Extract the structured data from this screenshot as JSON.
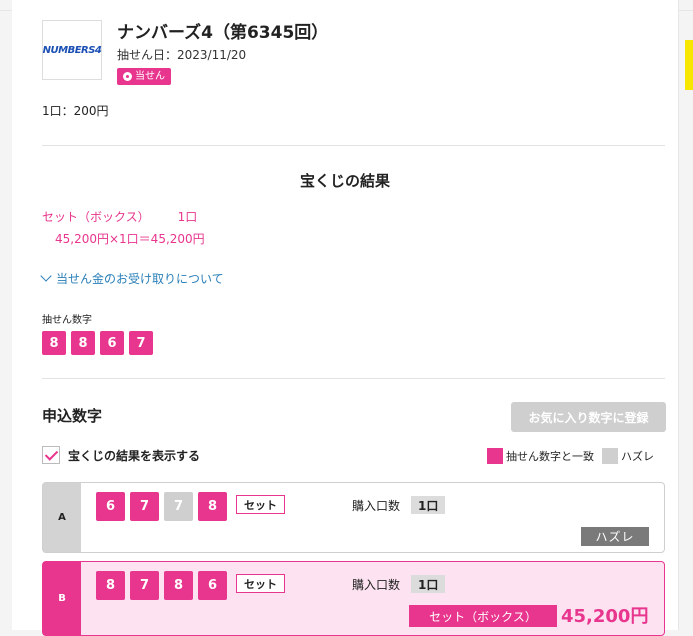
{
  "lottery": {
    "title": "ナンバーズ4（第6345回）",
    "draw_date": "抽せん日：2023/11/20",
    "badge": "当せん",
    "logo_text": "NUMBERS4",
    "price": "1口：200円"
  },
  "results": {
    "heading": "宝くじの結果",
    "prize_type": "セット（ボックス）",
    "prize_count": "1口",
    "prize_calc": "45,200円×1口＝45,200円",
    "prize_link": "当せん金のお受け取りについて",
    "drawn_label": "抽せん数字",
    "drawn_digits": [
      "8",
      "8",
      "6",
      "7"
    ]
  },
  "entries": {
    "heading": "申込数字",
    "fav_button": "お気に入り数字に登録",
    "show_results_label": "宝くじの結果を表示する",
    "legend_match": "抽せん数字と一致",
    "legend_miss": "ハズレ",
    "colors": {
      "match": "#e8358e",
      "miss": "#cfcfcf"
    },
    "rows": [
      {
        "label": "A",
        "digits": [
          {
            "value": "6",
            "state": "hit"
          },
          {
            "value": "7",
            "state": "hit"
          },
          {
            "value": "7",
            "state": "miss"
          },
          {
            "value": "8",
            "state": "hit"
          }
        ],
        "type": "セット",
        "qty_label": "購入口数",
        "qty": "1口",
        "result": "ハズレ"
      },
      {
        "label": "B",
        "digits": [
          {
            "value": "8",
            "state": "hit"
          },
          {
            "value": "7",
            "state": "hit"
          },
          {
            "value": "8",
            "state": "hit"
          },
          {
            "value": "6",
            "state": "hit"
          }
        ],
        "type": "セット",
        "qty_label": "購入口数",
        "qty": "1口",
        "win_type": "セット（ボックス）",
        "win_amount": "45,200円"
      }
    ]
  }
}
